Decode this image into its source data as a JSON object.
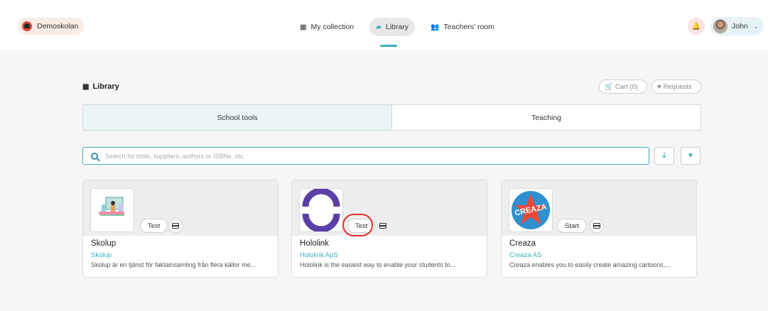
{
  "header": {
    "school_name": "Demoskolan",
    "nav": [
      {
        "label": "My collection",
        "icon": "grid-icon"
      },
      {
        "label": "Library",
        "icon": "book-icon"
      },
      {
        "label": "Teachers' room",
        "icon": "users-icon"
      }
    ],
    "active_nav": "Library",
    "user_name": "John"
  },
  "library": {
    "heading": "Library",
    "cart_label": "Cart (0)",
    "requests_label": "Requests",
    "tabs": [
      "School tools",
      "Teaching"
    ],
    "active_tab": "School tools",
    "search_placeholder": "Search for tools, suppliers, authors or ISBNs, etc."
  },
  "cards": [
    {
      "name": "Skolup",
      "supplier": "Skolup",
      "description": "Skolup är en tjänst för faktainsamling från flera källor me...",
      "action": "Test"
    },
    {
      "name": "Hololink",
      "supplier": "Hololink ApS",
      "description": "Hololink is the easiest way to enable your students to...",
      "action": "Test"
    },
    {
      "name": "Creaza",
      "supplier": "Creaza AS",
      "description": "Creaza enables you to easily create amazing cartoons,...",
      "action": "Start",
      "logo_text": "CREAZA"
    }
  ],
  "colors": {
    "accent": "#3aaec0",
    "highlight": "#e0302a"
  }
}
